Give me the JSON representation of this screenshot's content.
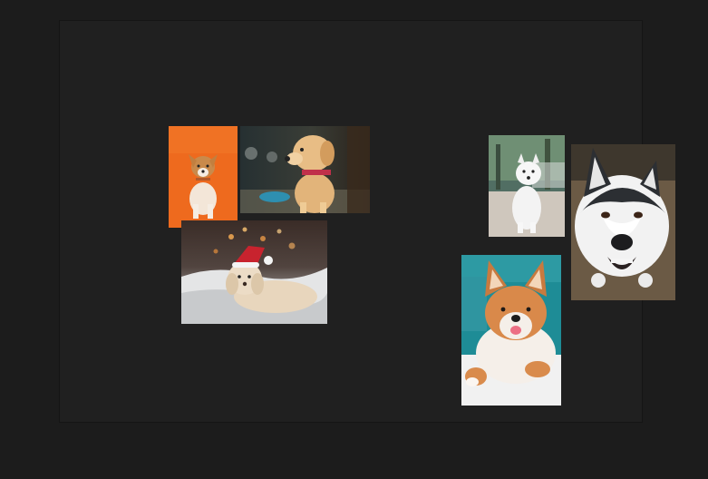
{
  "workspace": {
    "background_color": "#1c1c1c",
    "canvas_color": "#202020"
  },
  "photos": [
    {
      "name": "corgi-on-orange",
      "accent": "#ee6a1e"
    },
    {
      "name": "golden-retriever-puppy",
      "accent": "#e2b47a"
    },
    {
      "name": "poodle-puppy-santa-hat",
      "accent": "#e6d6bf"
    },
    {
      "name": "white-spitz-outdoors",
      "accent": "#f2f2f2"
    },
    {
      "name": "husky-closeup",
      "accent": "#6b5a45"
    },
    {
      "name": "shiba-inu-lying",
      "accent": "#d9894a"
    }
  ]
}
